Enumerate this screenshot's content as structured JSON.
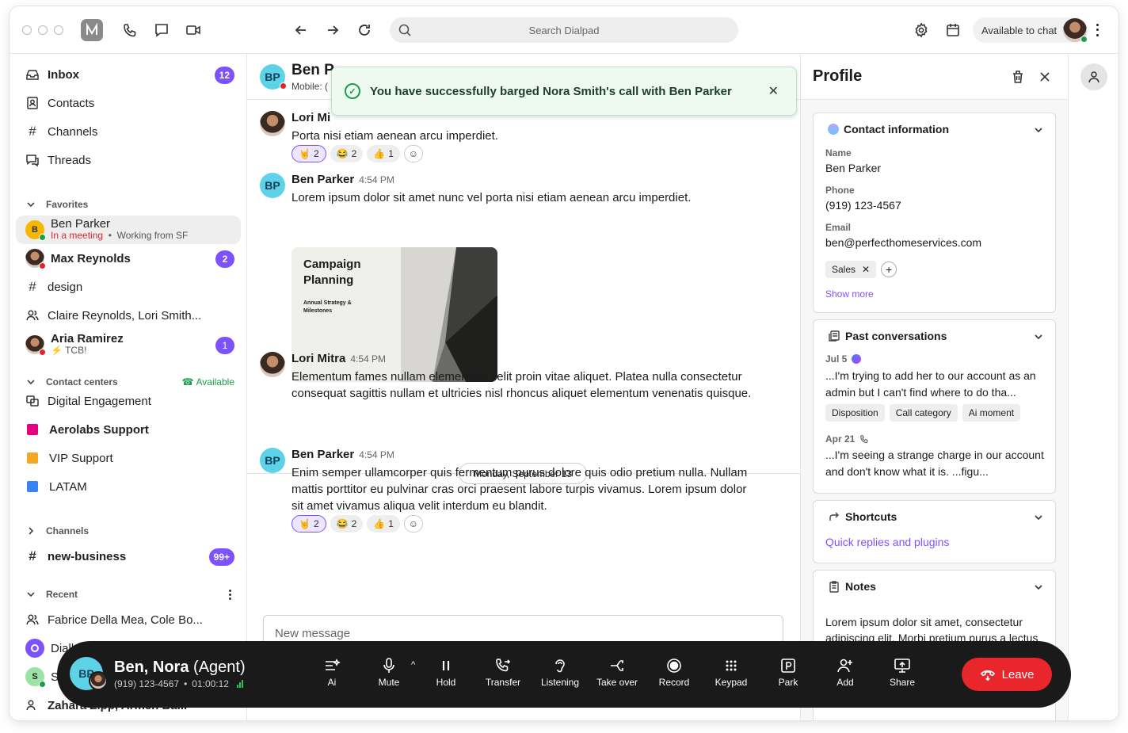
{
  "topbar": {
    "search_placeholder": "Search Dialpad",
    "status": "Available to chat"
  },
  "sidebar": {
    "nav": [
      {
        "label": "Inbox",
        "badge": "12"
      },
      {
        "label": "Contacts"
      },
      {
        "label": "Channels"
      },
      {
        "label": "Threads"
      }
    ],
    "favorites_label": "Favorites",
    "favorites": {
      "ben": {
        "initial": "B",
        "name": "Ben Parker",
        "status": "In a meeting",
        "note": "Working from SF"
      },
      "max": {
        "name": "Max Reynolds",
        "badge": "2"
      },
      "design": {
        "label": "design"
      },
      "group": {
        "label": "Claire Reynolds, Lori Smith..."
      },
      "aria": {
        "name": "Aria Ramirez",
        "note": "TCB!",
        "badge": "1"
      }
    },
    "contact_centers_label": "Contact centers",
    "contact_centers_status": "Available",
    "contact_centers": [
      {
        "label": "Digital Engagement"
      },
      {
        "label": "Aerolabs Support",
        "color": "#e6007e"
      },
      {
        "label": "VIP Support",
        "color": "#f5a623"
      },
      {
        "label": "LATAM",
        "color": "#3b82f6"
      }
    ],
    "channels_label": "Channels",
    "channel_item": {
      "label": "new-business",
      "badge": "99+"
    },
    "recent_label": "Recent",
    "recent": [
      {
        "label": "Fabrice Della Mea, Cole Bo..."
      },
      {
        "label": "Dialbot"
      },
      {
        "label": "Sa",
        "initial": "S"
      },
      {
        "label": "Zahara Zipp, Armen Ba..."
      }
    ]
  },
  "chat": {
    "header": {
      "initials": "BP",
      "name": "Ben P",
      "sub": "Mobile: ("
    },
    "toast": "You have successfully barged Nora Smith's call with Ben Parker",
    "messages": [
      {
        "name": "Lori Mi",
        "time": "",
        "body": "Porta nisi etiam aenean arcu imperdiet."
      },
      {
        "name": "Ben Parker",
        "initials": "BP",
        "time": "4:54 PM",
        "body": "Lorem ipsum dolor sit amet nunc vel porta nisi etiam aenean arcu imperdiet."
      },
      {
        "name": "Lori Mitra",
        "time": "4:54 PM",
        "body": "Elementum fames nullam elementum velit proin vitae aliquet. Platea nulla consectetur consequat sagittis nullam et ultricies nisl rhoncus aliquet elementum venenatis quisque."
      },
      {
        "name": "Ben Parker",
        "initials": "BP",
        "time": "4:54 PM",
        "body": "Enim semper ullamcorper quis fermentum purus dolore quis odio pretium nulla. Nullam mattis porttitor eu pulvinar cras orci praesent labore turpis vivamus. Lorem ipsum dolor sit amet vivamus aliqua velit interdum eu blandit."
      }
    ],
    "reactions": [
      {
        "emoji": "🤘",
        "count": "2"
      },
      {
        "emoji": "😂",
        "count": "2"
      },
      {
        "emoji": "👍",
        "count": "1"
      }
    ],
    "attachment": {
      "title": "Campaign Planning",
      "subtitle": "Annual Strategy & Milestones"
    },
    "day_separator": "Monday, September 13",
    "composer_placeholder": "New message"
  },
  "profile": {
    "title": "Profile",
    "contact_info": {
      "title": "Contact information",
      "name_label": "Name",
      "name": "Ben Parker",
      "phone_label": "Phone",
      "phone": "(919) 123-4567",
      "email_label": "Email",
      "email": "ben@perfecthomeservices.com",
      "tag": "Sales",
      "show_more": "Show more"
    },
    "past": {
      "title": "Past conversations",
      "items": [
        {
          "date": "Jul 5",
          "text": "...I'm trying to add her to our account as an admin but I can't find where to do tha..."
        },
        {
          "date": "Apr 21",
          "text": "...I'm seeing a strange charge in our account and don't know what it is. ...figu..."
        }
      ],
      "tags": [
        "Disposition",
        "Call category",
        "Ai moment"
      ]
    },
    "shortcuts": {
      "title": "Shortcuts",
      "link": "Quick replies and plugins"
    },
    "notes": {
      "title": "Notes",
      "text": "Lorem ipsum dolor sit amet, consectetur adipiscing elit. Morbi pretium purus a lectus volutpat vestibulum. Maecenas leo ellis, lacinia a bibendum porttitor sit amet mi. Phasellus malesuada lorem in velit luctus"
    }
  },
  "callbar": {
    "initials": "BP",
    "name": "Ben, Nora",
    "role": "(Agent)",
    "number": "(919) 123-4567",
    "timer": "01:00:12",
    "buttons": [
      "Ai",
      "Mute",
      "Hold",
      "Transfer",
      "Listening",
      "Take over",
      "Record",
      "Keypad",
      "Park",
      "Add",
      "Share"
    ],
    "leave": "Leave"
  }
}
